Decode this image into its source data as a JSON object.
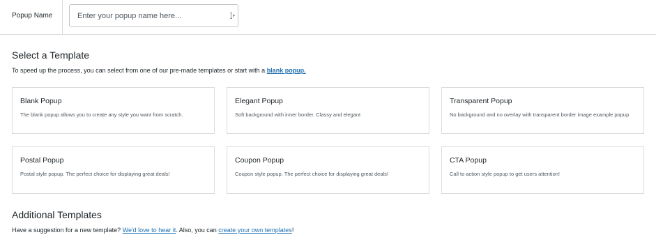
{
  "popup_name": {
    "label": "Popup Name",
    "placeholder": "Enter your popup name here...",
    "value": ""
  },
  "select_template": {
    "title": "Select a Template",
    "desc_prefix": "To speed up the process, you can select from one of our pre-made templates or start with a ",
    "desc_link": "blank popup.",
    "templates": [
      {
        "title": "Blank Popup",
        "description": "The blank popup allows you to create any style you want from scratch."
      },
      {
        "title": "Elegant Popup",
        "description": "Soft background with inner border. Classy and elegant"
      },
      {
        "title": "Transparent Popup",
        "description": "No background and no overlay with transparent border image example popup"
      },
      {
        "title": "Postal Popup",
        "description": "Postal style popup. The perfect choice for displaying great deals!"
      },
      {
        "title": "Coupon Popup",
        "description": "Coupon style popup. The perfect choice for displaying great deals!"
      },
      {
        "title": "CTA Popup",
        "description": "Call to action style popup to get users attention!"
      }
    ]
  },
  "additional_templates": {
    "title": "Additional Templates",
    "text_1": "Have a suggestion for a new template? ",
    "link_1": "We'd love to hear it",
    "text_2": ". Also, you can ",
    "link_2": "create your own templates",
    "text_3": "!"
  },
  "colors": {
    "link": "#2271b1",
    "border": "#dcdcde",
    "text": "#1d2327",
    "muted": "#50575e"
  },
  "icons": {
    "input_icon": "text-cursor-icon"
  }
}
